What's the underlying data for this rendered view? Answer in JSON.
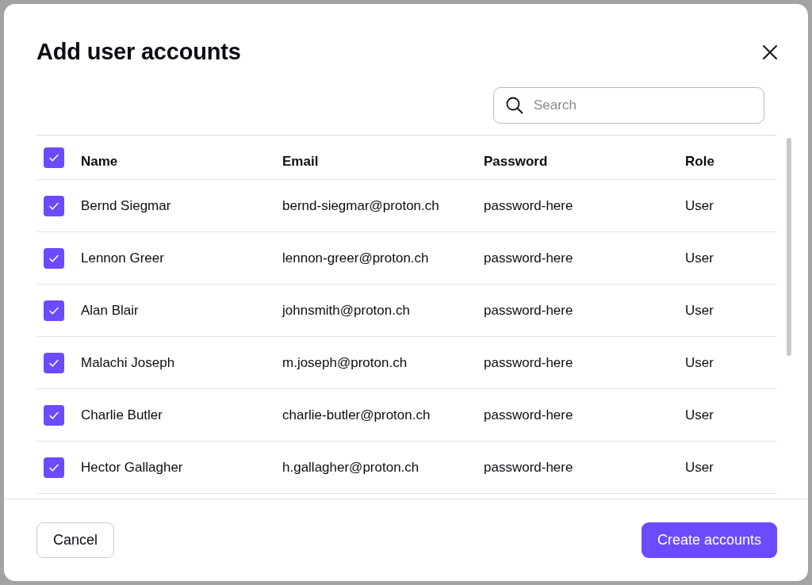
{
  "dialog": {
    "title": "Add user accounts"
  },
  "search": {
    "placeholder": "Search"
  },
  "table": {
    "select_all": {
      "checked": true
    },
    "columns": [
      "Name",
      "Email",
      "Password",
      "Role"
    ],
    "rows": [
      {
        "checked": true,
        "cells": [
          "Bernd Siegmar",
          "bernd-siegmar@proton.ch",
          "password-here",
          "User"
        ]
      },
      {
        "checked": true,
        "cells": [
          "Lennon Greer",
          "lennon-greer@proton.ch",
          "password-here",
          "User"
        ]
      },
      {
        "checked": true,
        "cells": [
          "Alan Blair",
          "johnsmith@proton.ch",
          "password-here",
          "User"
        ]
      },
      {
        "checked": true,
        "cells": [
          "Malachi Joseph",
          "m.joseph@proton.ch",
          "password-here",
          "User"
        ]
      },
      {
        "checked": true,
        "cells": [
          "Charlie Butler",
          "charlie-butler@proton.ch",
          "password-here",
          "User"
        ]
      },
      {
        "checked": true,
        "cells": [
          "Hector Gallagher",
          "h.gallagher@proton.ch",
          "password-here",
          "User"
        ]
      }
    ]
  },
  "buttons": [
    {
      "label": "Cancel",
      "kind": "secondary"
    },
    {
      "label": "Create accounts",
      "kind": "primary"
    }
  ]
}
